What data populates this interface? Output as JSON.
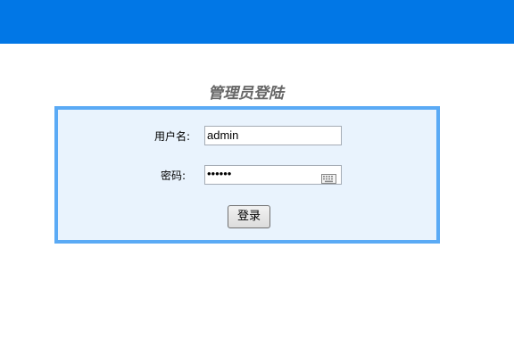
{
  "header": {
    "color": "#0177e6"
  },
  "page_title": "管理员登陆",
  "form": {
    "username_label": "用户名:",
    "username_value": "admin",
    "password_label": "密码:",
    "password_masked": "••••••",
    "keyboard_icon": "keyboard-icon",
    "submit_label": "登录"
  },
  "colors": {
    "panel_background": "#e9f3fd",
    "panel_border": "#5aaaf5",
    "title_text": "#666666"
  }
}
